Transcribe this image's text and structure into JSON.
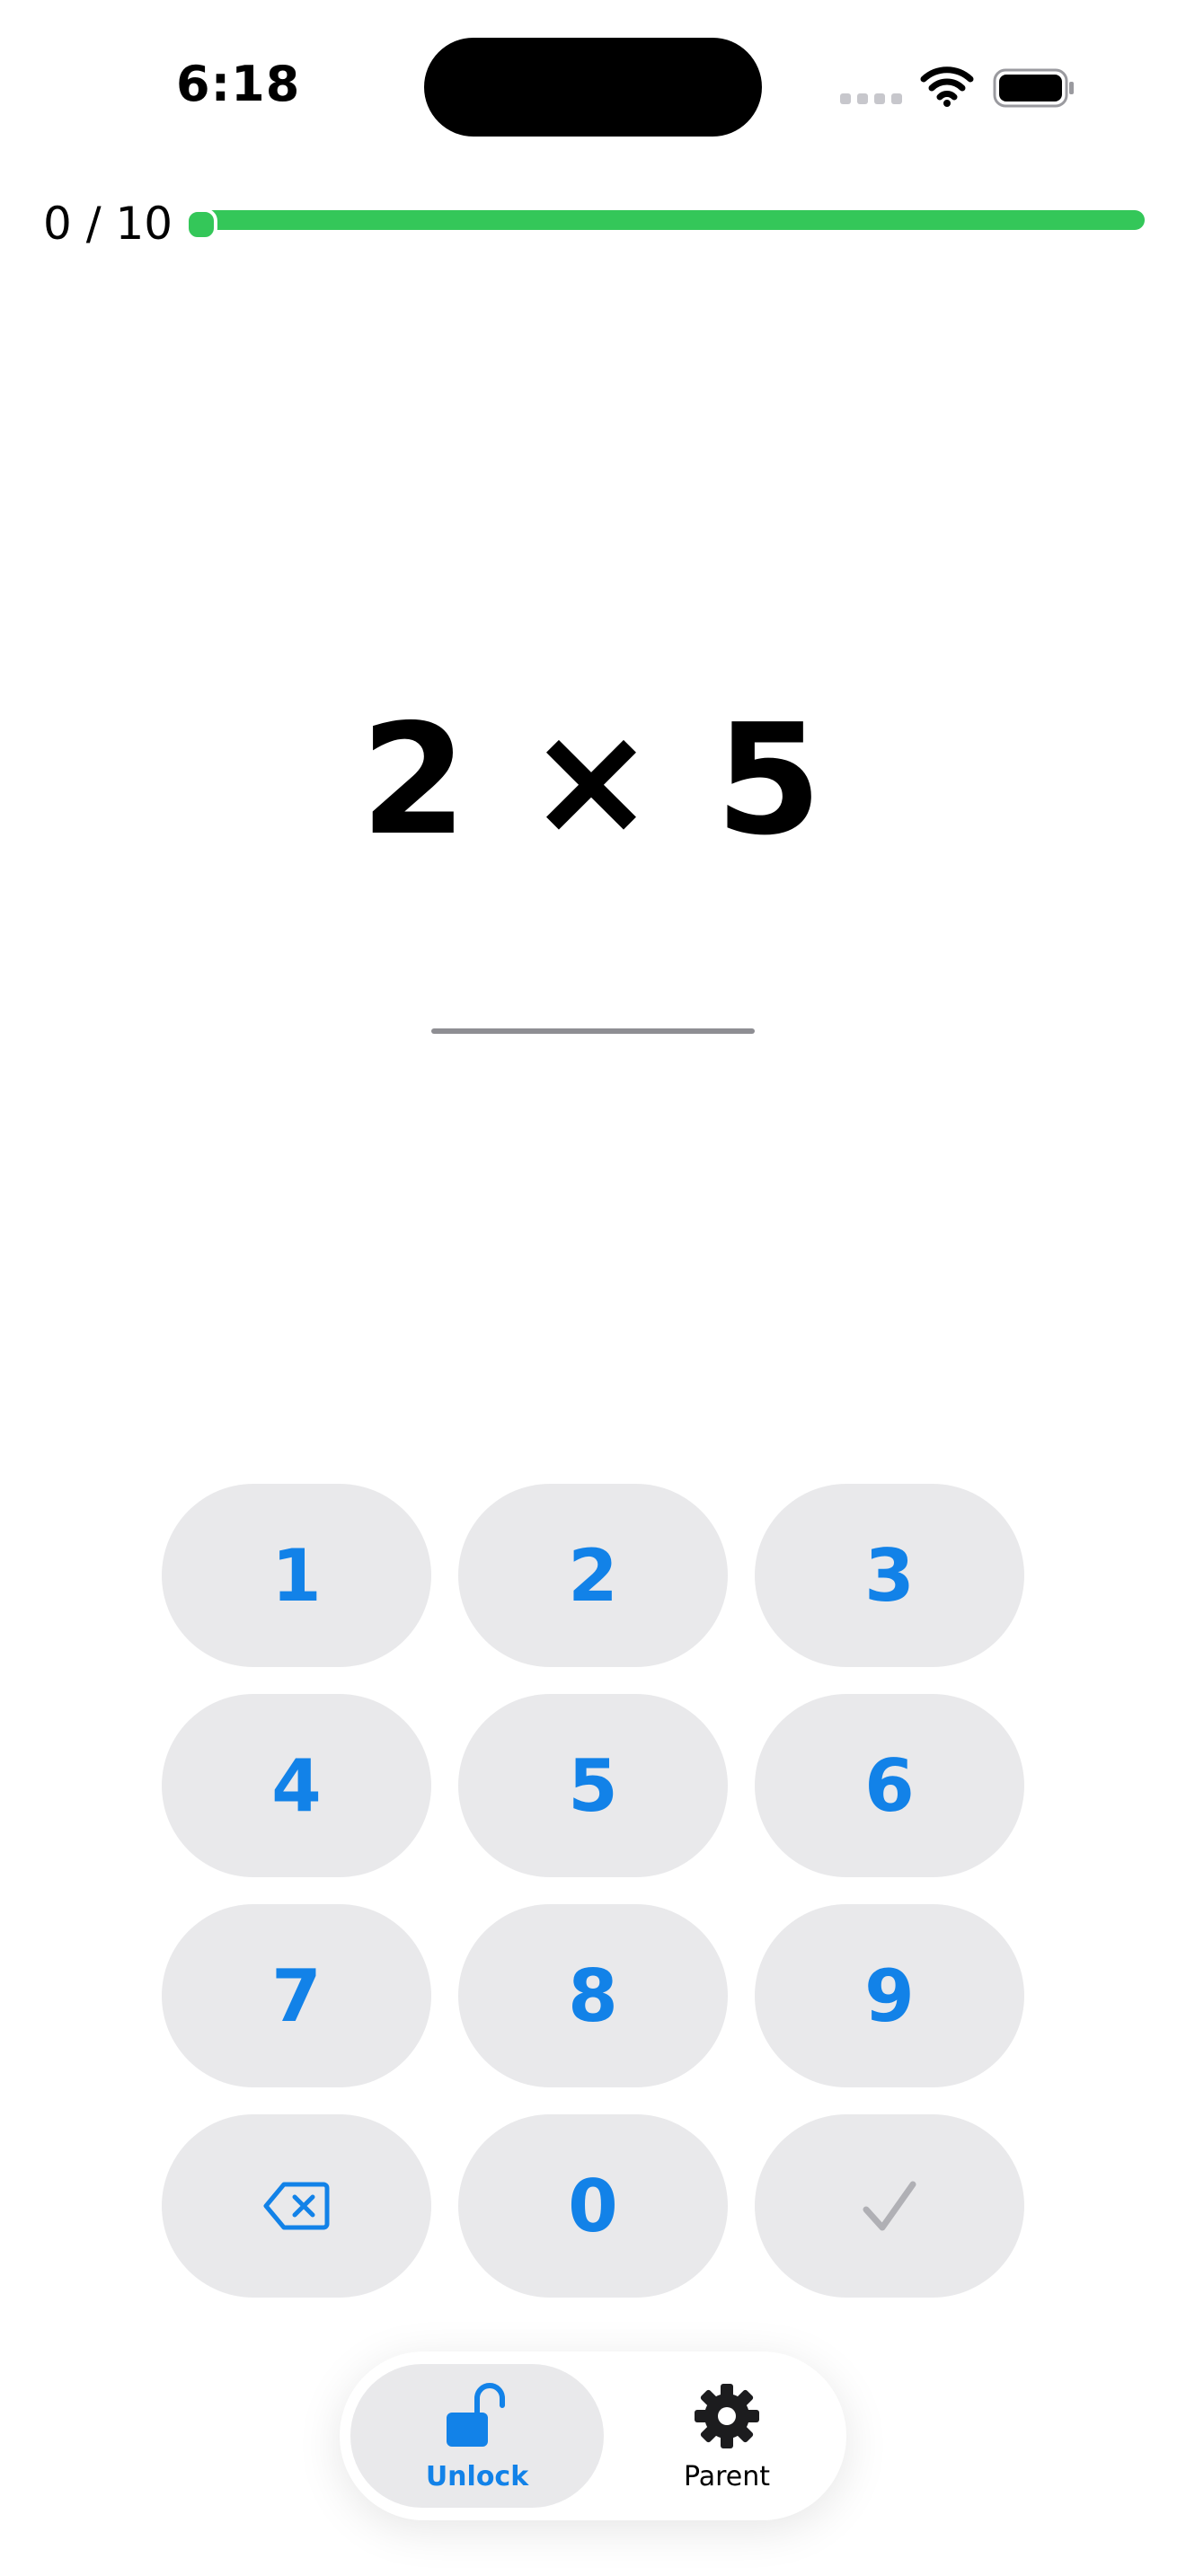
{
  "status_bar": {
    "time": "6:18"
  },
  "progress": {
    "label": "0 / 10",
    "value": 0,
    "total": 10
  },
  "question": {
    "text": "2 × 5",
    "answer": ""
  },
  "keypad": {
    "keys": [
      "1",
      "2",
      "3",
      "4",
      "5",
      "6",
      "7",
      "8",
      "9"
    ],
    "zero": "0",
    "delete_icon": "delete-left-icon",
    "submit_icon": "checkmark-icon"
  },
  "tabs": {
    "unlock": {
      "label": "Unlock",
      "icon": "lock-open-icon"
    },
    "parent": {
      "label": "Parent",
      "icon": "gear-icon"
    }
  },
  "colors": {
    "accent": "#1282E8",
    "progress": "#34C759",
    "key_bg": "#E9E9EB",
    "disabled": "#B0B0B5"
  }
}
